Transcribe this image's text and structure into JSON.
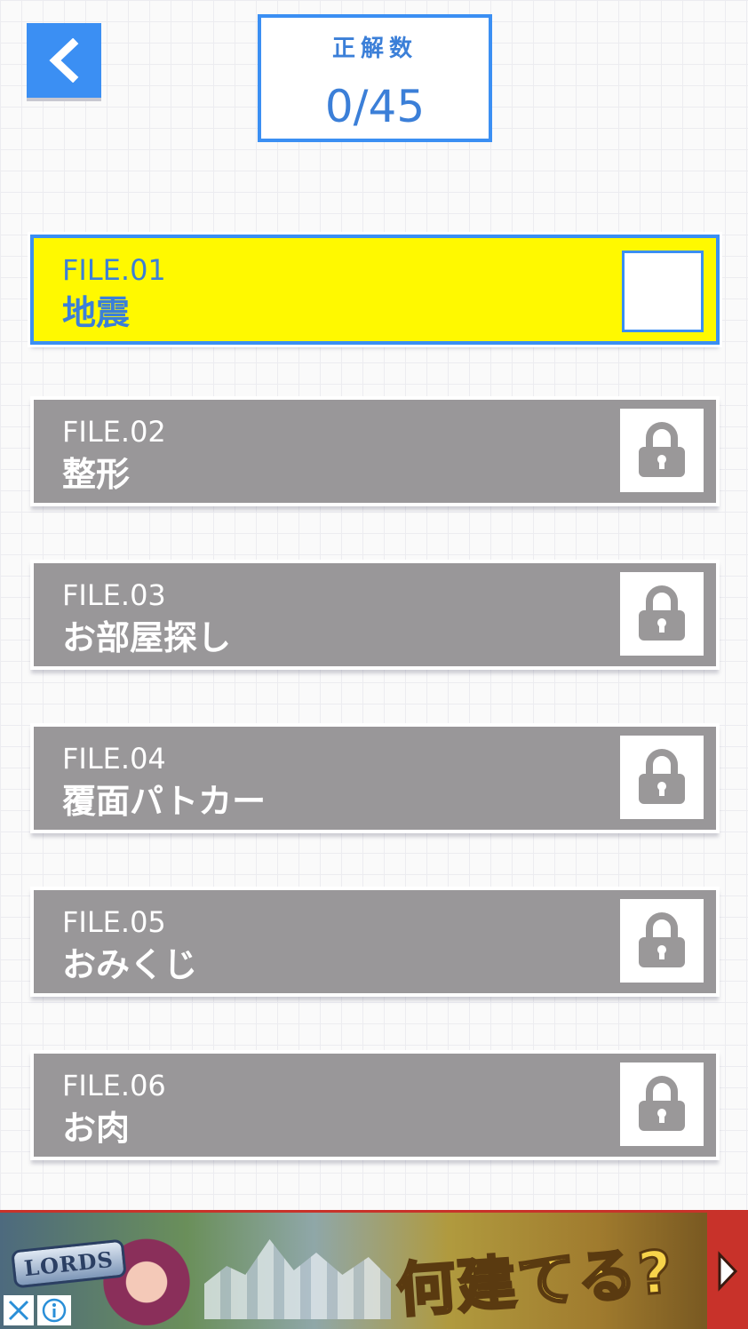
{
  "header": {
    "back_icon": "chevron-left-icon",
    "score_label": "正解数",
    "score_value": "0/45"
  },
  "colors": {
    "accent": "#3b8ff3",
    "open_card": "#fff900",
    "locked_card": "#999799",
    "ad_border": "#c8322a"
  },
  "files": [
    {
      "number": "FILE.01",
      "title": "地震",
      "state": "open",
      "icon": "empty-checkbox"
    },
    {
      "number": "FILE.02",
      "title": "整形",
      "state": "locked",
      "icon": "lock-icon"
    },
    {
      "number": "FILE.03",
      "title": "お部屋探し",
      "state": "locked",
      "icon": "lock-icon"
    },
    {
      "number": "FILE.04",
      "title": "覆面パトカー",
      "state": "locked",
      "icon": "lock-icon"
    },
    {
      "number": "FILE.05",
      "title": "おみくじ",
      "state": "locked",
      "icon": "lock-icon"
    },
    {
      "number": "FILE.06",
      "title": "お肉",
      "state": "locked",
      "icon": "lock-icon"
    }
  ],
  "ad": {
    "logo_text": "LORDS",
    "headline": "何建てる?",
    "close_icon": "close-icon",
    "info_icon": "info-icon",
    "next_icon": "play-arrow-icon"
  }
}
